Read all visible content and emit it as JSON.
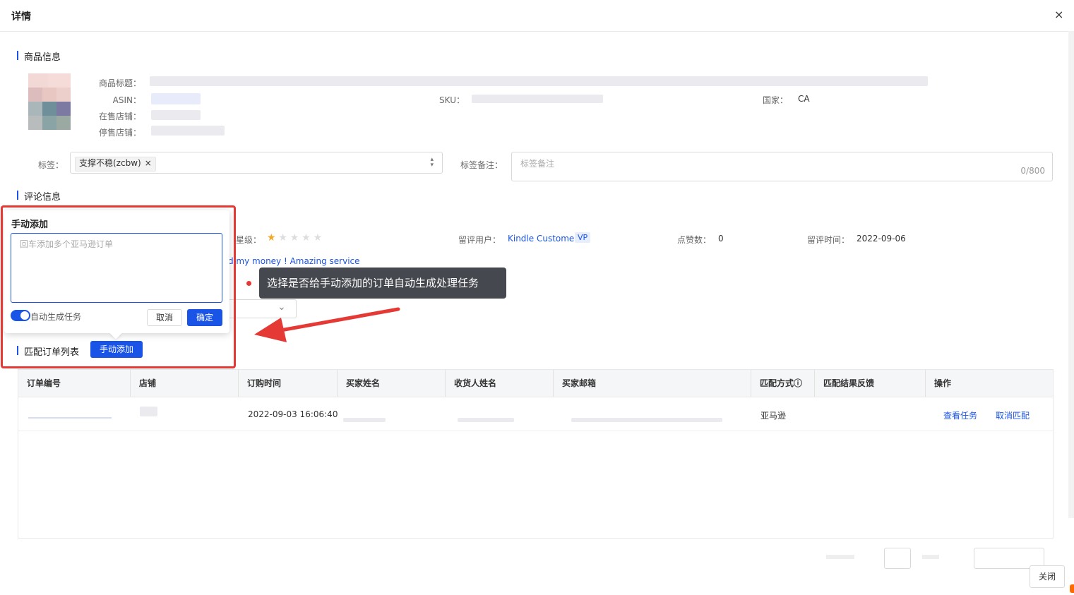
{
  "header": {
    "title": "详情",
    "close_icon": "×"
  },
  "product": {
    "section_title": "商品信息",
    "title_label": "商品标题：",
    "asin_label": "ASIN：",
    "sku_label": "SKU：",
    "country_label": "国家：",
    "country_value": "CA",
    "on_sale_store_label": "在售店铺：",
    "stopped_store_label": "停售店铺："
  },
  "tags": {
    "label": "标签：",
    "chip_text": "支撑不稳(zcbw)",
    "chip_remove": "×",
    "arrows": "⌃⌄",
    "remark_label": "标签备注：",
    "remark_placeholder": "标签备注",
    "remark_count": "0/800"
  },
  "review": {
    "section_title": "评论信息",
    "rating_label": "星级：",
    "rating": 1,
    "rating_max": 5,
    "user_label": "留评用户：",
    "user_name": "Kindle Customer",
    "vp_badge": "VP",
    "likes_label": "点赞数：",
    "likes_value": "0",
    "time_label": "留评时间：",
    "time_value": "2022-09-06",
    "content_fragment": "d my money ! Amazing service",
    "dropdown_arrow": "⌄"
  },
  "popover": {
    "title": "手动添加",
    "textarea_placeholder": "回车添加多个亚马逊订单",
    "toggle_label": "自动生成任务",
    "toggle_on": true,
    "cancel": "取消",
    "confirm": "确定"
  },
  "annotation": {
    "tooltip": "选择是否给手动添加的订单自动生成处理任务",
    "arrow_color": "#e53935"
  },
  "orders": {
    "section_title": "匹配订单列表",
    "add_button": "手动添加",
    "columns": [
      "订单编号",
      "店铺",
      "订购时间",
      "买家姓名",
      "收货人姓名",
      "买家邮箱",
      "匹配方式ⓘ",
      "匹配结果反馈",
      "操作"
    ],
    "rows": [
      {
        "order_time": "2022-09-03 16:06:40",
        "match_method": "亚马逊",
        "action_view": "查看任务",
        "action_cancel": "取消匹配"
      }
    ]
  },
  "footer": {
    "close_button": "关闭"
  },
  "colors": {
    "primary": "#1a54e6",
    "annotation_red": "#e53935",
    "tooltip_bg": "#45484f",
    "star": "#f5a623"
  }
}
